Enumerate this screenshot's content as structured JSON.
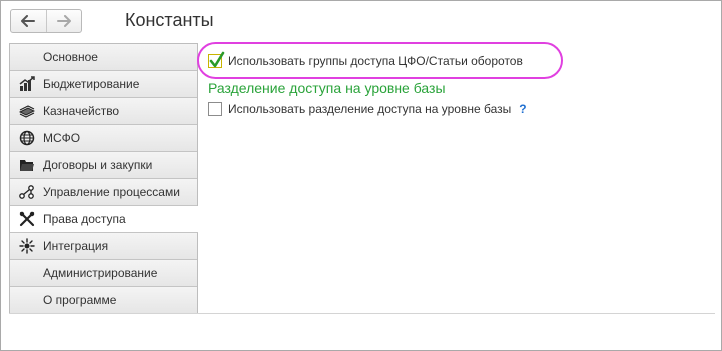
{
  "header": {
    "title": "Константы",
    "back_icon": "arrow-left-icon",
    "forward_icon": "arrow-right-icon"
  },
  "sidebar": {
    "items": [
      {
        "label": "Основное",
        "icon": ""
      },
      {
        "label": "Бюджетирование",
        "icon": "budget-chart-icon"
      },
      {
        "label": "Казначейство",
        "icon": "money-stack-icon"
      },
      {
        "label": "МСФО",
        "icon": "globe-icon"
      },
      {
        "label": "Договоры и закупки",
        "icon": "folder-icon"
      },
      {
        "label": "Управление процессами",
        "icon": "process-graph-icon"
      },
      {
        "label": "Права доступа",
        "icon": "tools-icon",
        "active": true
      },
      {
        "label": "Интеграция",
        "icon": "integration-sun-icon"
      },
      {
        "label": "Администрирование",
        "icon": ""
      },
      {
        "label": "О программе",
        "icon": ""
      }
    ]
  },
  "content": {
    "access_groups_checkbox": {
      "label": "Использовать группы доступа ЦФО/Статьи оборотов",
      "checked": true
    },
    "section_title": "Разделение доступа на уровне базы",
    "separation_checkbox": {
      "label": "Использовать разделение доступа на уровне базы",
      "checked": false
    },
    "help_label": "?"
  },
  "colors": {
    "section_title": "#2aa33a",
    "highlight_oval": "#e040e0",
    "checkmark": "#2a9a2a",
    "help": "#1f6fd0"
  }
}
